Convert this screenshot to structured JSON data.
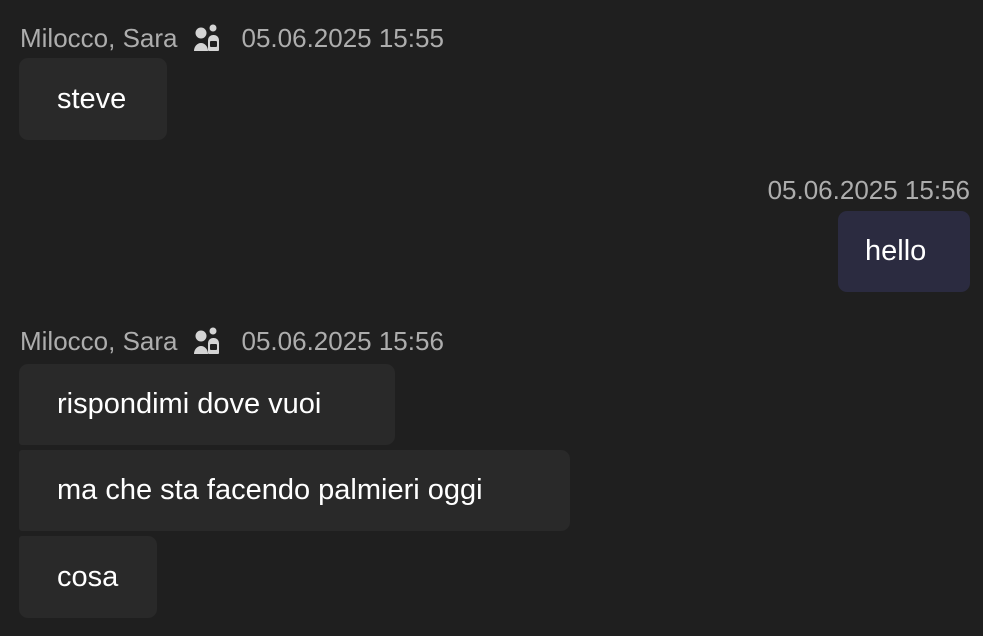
{
  "messages": [
    {
      "type": "incoming",
      "author": "Milocco, Sara",
      "author_icon": "external-user-icon",
      "timestamp": "05.06.2025 15:55",
      "bubbles": [
        "steve"
      ]
    },
    {
      "type": "outgoing",
      "timestamp": "05.06.2025 15:56",
      "bubbles": [
        "hello"
      ]
    },
    {
      "type": "incoming",
      "author": "Milocco, Sara",
      "author_icon": "external-user-icon",
      "timestamp": "05.06.2025 15:56",
      "bubbles": [
        "rispondimi dove vuoi",
        "ma che sta facendo palmieri oggi",
        "cosa"
      ]
    }
  ],
  "colors": {
    "background": "#1f1f1f",
    "incoming_bubble": "#292929",
    "outgoing_bubble": "#2b2b40",
    "meta_text": "#adadad",
    "message_text": "#ffffff"
  }
}
